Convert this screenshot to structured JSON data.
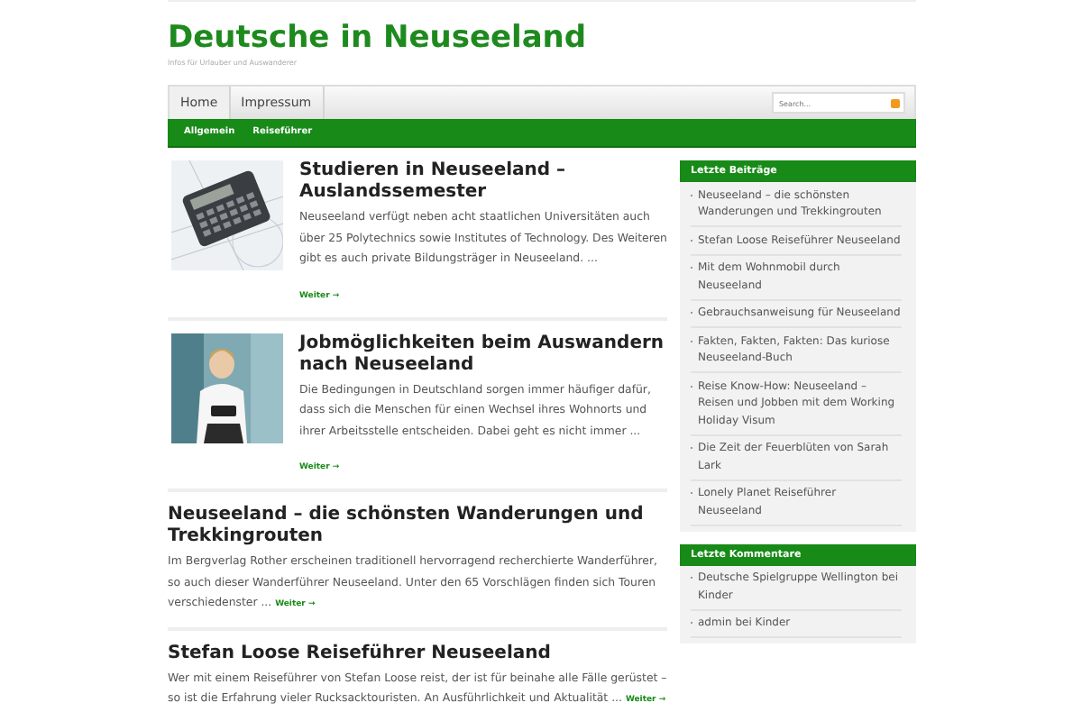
{
  "site": {
    "title": "Deutsche in Neuseeland",
    "tagline": "Infos für Urlauber und Auswanderer"
  },
  "top_nav": [
    {
      "label": "Home",
      "selected": true
    },
    {
      "label": "Impressum",
      "selected": false
    }
  ],
  "search": {
    "placeholder": "Search..."
  },
  "category_nav": [
    {
      "label": "Allgemein"
    },
    {
      "label": "Reiseführer"
    }
  ],
  "posts": [
    {
      "title": "Studieren in Neuseeland – Auslandssemester",
      "kind": "picture",
      "excerpt": "Neuseeland verfügt neben acht staatlichen Universitäten auch über 25 Polytechnics sowie Institutes of Technology. Des Weiteren gibt es auch private Bildungsträger in Neuseeland. ...",
      "more": "Weiter →"
    },
    {
      "title": "Jobmöglichkeiten beim Auswandern nach Neuseeland",
      "kind": "picture",
      "excerpt": "Die Bedingungen in Deutschland sorgen immer häufiger dafür, dass sich die Menschen für einen Wechsel ihres Wohnorts und ihrer Arbeitsstelle entscheiden. Dabei geht es nicht immer ...",
      "more": "Weiter →"
    },
    {
      "title": "Neuseeland – die schönsten Wanderungen und Trekkingrouten",
      "excerpt": "Im Bergverlag Rother erscheinen traditionell hervorragend recherchierte Wanderführer, so auch dieser Wanderführer Neuseeland. Unter den 65 Vorschlägen finden sich Touren verschiedenster ...",
      "more": "Weiter →"
    },
    {
      "title": "Stefan Loose Reiseführer Neuseeland",
      "excerpt": "Wer mit einem Reiseführer von Stefan Loose reist, der ist für beinahe alle Fälle gerüstet – so ist die Erfahrung vieler Rucksacktouristen. An Ausführlichkeit und Aktualität ...",
      "more": "Weiter →"
    }
  ],
  "sidebar": [
    {
      "heading": "Letzte Beiträge",
      "items": [
        "Neuseeland – die schönsten Wanderungen und Trekkingrouten",
        "Stefan Loose Reiseführer Neuseeland",
        "Mit dem Wohnmobil durch Neuseeland",
        "Gebrauchsanweisung für Neuseeland",
        "Fakten, Fakten, Fakten: Das kuriose Neuseeland-Buch",
        "Reise Know-How: Neuseeland – Reisen und Jobben mit dem Working Holiday Visum",
        "Die Zeit der Feuerblüten von Sarah Lark",
        "Lonely Planet Reiseführer Neuseeland"
      ]
    },
    {
      "heading": "Letzte Kommentare",
      "items": [
        "Deutsche Spielgruppe Wellington bei Kinder",
        "admin bei Kinder"
      ]
    }
  ]
}
